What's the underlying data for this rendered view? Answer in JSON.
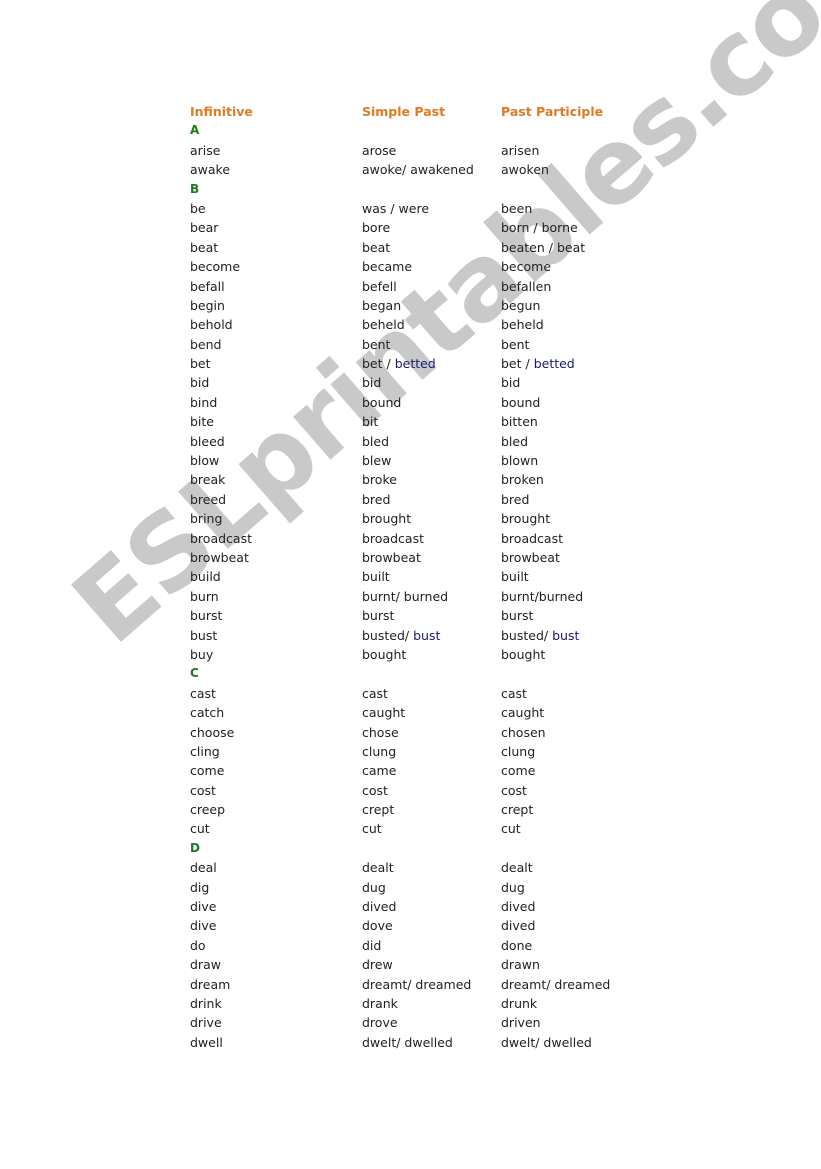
{
  "watermark": "ESLprintables.com",
  "colors": {
    "header": "#e07b24",
    "letter": "#1d7a1d",
    "alt_form": "#1a1a6e",
    "text": "#222222",
    "watermark": "#c9c9c9"
  },
  "headers": {
    "infinitive": "Infinitive",
    "simple_past": "Simple Past",
    "past_participle": "Past Participle"
  },
  "rows": [
    {
      "letter": "A"
    },
    {
      "inf": "arise",
      "past": "arose",
      "pp": "arisen"
    },
    {
      "inf": "awake",
      "past": "awoke/ awakened",
      "pp": "awoken"
    },
    {
      "letter": "B"
    },
    {
      "inf": "be",
      "past": "was / were",
      "pp": "been"
    },
    {
      "inf": "bear",
      "past": "bore",
      "pp": "born / borne"
    },
    {
      "inf": "beat",
      "past": "beat",
      "pp": "beaten / beat"
    },
    {
      "inf": "become",
      "past": "became",
      "pp": "become"
    },
    {
      "inf": "befall",
      "past": "befell",
      "pp": "befallen"
    },
    {
      "inf": "begin",
      "past": "began",
      "pp": "begun"
    },
    {
      "inf": "behold",
      "past": "beheld",
      "pp": "beheld"
    },
    {
      "inf": "bend",
      "past": "bent",
      "pp": "bent"
    },
    {
      "inf": "bet",
      "past": "bet / ",
      "past_alt": "betted",
      "pp": "bet / ",
      "pp_alt": "betted"
    },
    {
      "inf": "bid",
      "past": "bid",
      "pp": "bid"
    },
    {
      "inf": "bind",
      "past": "bound",
      "pp": "bound"
    },
    {
      "inf": "bite",
      "past": "bit",
      "pp": "bitten"
    },
    {
      "inf": "bleed",
      "past": "bled",
      "pp": "bled"
    },
    {
      "inf": "blow",
      "past": "blew",
      "pp": "blown"
    },
    {
      "inf": "break",
      "past": "broke",
      "pp": "broken"
    },
    {
      "inf": "breed",
      "past": "bred",
      "pp": "bred"
    },
    {
      "inf": "bring",
      "past": "brought",
      "pp": "brought"
    },
    {
      "inf": "broadcast",
      "past": "broadcast",
      "pp": "broadcast"
    },
    {
      "inf": "browbeat",
      "past": "browbeat",
      "pp": "browbeat"
    },
    {
      "inf": "build",
      "past": "built",
      "pp": "built"
    },
    {
      "inf": "burn",
      "past": "burnt/ burned",
      "pp": "burnt/burned"
    },
    {
      "inf": "burst",
      "past": "burst",
      "pp": "burst"
    },
    {
      "inf": "bust",
      "past": "busted/ ",
      "past_alt": "bust",
      "pp": "busted/ ",
      "pp_alt": "bust"
    },
    {
      "inf": "buy",
      "past": "bought",
      "pp": "bought"
    },
    {
      "letter": "C"
    },
    {
      "inf": "cast",
      "past": "cast",
      "pp": "cast"
    },
    {
      "inf": "catch",
      "past": "caught",
      "pp": "caught"
    },
    {
      "inf": "choose",
      "past": "chose",
      "pp": "chosen"
    },
    {
      "inf": "cling",
      "past": "clung",
      "pp": "clung"
    },
    {
      "inf": "come",
      "past": "came",
      "pp": "come"
    },
    {
      "inf": "cost",
      "past": "cost",
      "pp": "cost"
    },
    {
      "inf": "creep",
      "past": "crept",
      "pp": "crept"
    },
    {
      "inf": "cut",
      "past": "cut",
      "pp": "cut"
    },
    {
      "letter": "D"
    },
    {
      "inf": "deal",
      "past": "dealt",
      "pp": "dealt"
    },
    {
      "inf": "dig",
      "past": "dug",
      "pp": "dug"
    },
    {
      "inf": "dive",
      "past": "dived",
      "pp": "dived"
    },
    {
      "inf": "dive",
      "past": "dove",
      "pp": "dived"
    },
    {
      "inf": "do",
      "past": "did",
      "pp": "done"
    },
    {
      "inf": "draw",
      "past": "drew",
      "pp": "drawn"
    },
    {
      "inf": "dream",
      "past": "dreamt/ dreamed",
      "pp": "dreamt/ dreamed"
    },
    {
      "inf": "drink",
      "past": "drank",
      "pp": "drunk"
    },
    {
      "inf": "drive",
      "past": "drove",
      "pp": "driven"
    },
    {
      "inf": "dwell",
      "past": "dwelt/ dwelled",
      "pp": "dwelt/ dwelled"
    }
  ]
}
